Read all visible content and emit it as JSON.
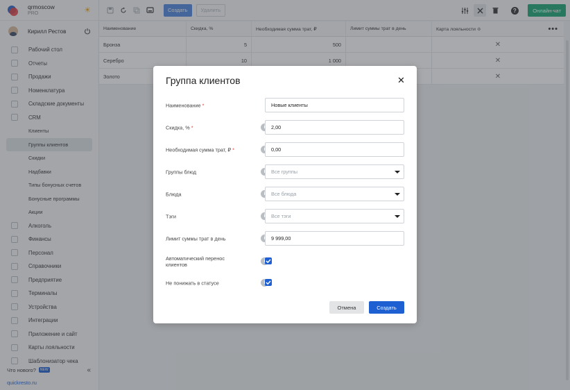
{
  "brand": {
    "name": "qrmoscow",
    "plan": "PRO"
  },
  "user": {
    "name": "Кирилл Рестов"
  },
  "sidebar": {
    "items": [
      {
        "label": "Рабочий стол",
        "icon": "home-icon"
      },
      {
        "label": "Отчеты",
        "icon": "chart-icon"
      },
      {
        "label": "Продажи",
        "icon": "sales-icon"
      },
      {
        "label": "Номенклатура",
        "icon": "tag-icon"
      },
      {
        "label": "Складские документы",
        "icon": "document-icon"
      },
      {
        "label": "CRM",
        "icon": "crm-icon"
      }
    ],
    "crm_sub": [
      {
        "label": "Клиенты"
      },
      {
        "label": "Группы клиентов",
        "active": true
      },
      {
        "label": "Скидки"
      },
      {
        "label": "Надбавки"
      },
      {
        "label": "Типы бонусных счетов"
      },
      {
        "label": "Бонусные программы"
      },
      {
        "label": "Акции"
      }
    ],
    "items_after": [
      {
        "label": "Алкоголь",
        "icon": "glass-icon"
      },
      {
        "label": "Финансы",
        "icon": "wallet-icon"
      },
      {
        "label": "Персонал",
        "icon": "staff-icon"
      },
      {
        "label": "Справочники",
        "icon": "book-icon"
      },
      {
        "label": "Предприятие",
        "icon": "building-icon"
      },
      {
        "label": "Терминалы",
        "icon": "terminal-icon"
      },
      {
        "label": "Устройства",
        "icon": "device-icon"
      },
      {
        "label": "Интеграции",
        "icon": "link-icon"
      },
      {
        "label": "Приложение и сайт",
        "icon": "app-icon"
      },
      {
        "label": "Карты лояльности",
        "icon": "card-icon"
      },
      {
        "label": "Шаблонизатор чека",
        "icon": "receipt-icon"
      }
    ],
    "whats_new": "Что нового?",
    "new_badge": "NEW",
    "site": "quickresto.ru"
  },
  "toolbar": {
    "create_label": "Создать",
    "delete_label": "Удалить",
    "chat_label": "Онлайн-чат"
  },
  "table": {
    "headers": [
      "Наименование",
      "Скидка, %",
      "Необходимая сумма трат, ₽",
      "Лимит суммы трат в день",
      "Карта лояльности ≎"
    ],
    "rows": [
      {
        "name": "Бронза",
        "discount": "5",
        "sum": "500",
        "limit": "",
        "card": "✕"
      },
      {
        "name": "Серебро",
        "discount": "10",
        "sum": "1 000",
        "limit": "",
        "card": "✕"
      },
      {
        "name": "Золото",
        "discount": "",
        "sum": "",
        "limit": "",
        "card": "✕"
      }
    ]
  },
  "modal": {
    "title": "Группа клиентов",
    "fields": {
      "name_label": "Наименование",
      "name_value": "Новые клиенты",
      "discount_label": "Скидка, %",
      "discount_value": "2,00",
      "sum_label": "Необходимая сумма трат, ₽",
      "sum_value": "0,00",
      "dish_groups_label": "Группы блюд",
      "dish_groups_placeholder": "Все группы",
      "dishes_label": "Блюда",
      "dishes_placeholder": "Все блюда",
      "tags_label": "Тэги",
      "tags_placeholder": "Все тэги",
      "limit_label": "Лимит суммы трат в день",
      "limit_value": "9 999,00",
      "auto_transfer_label": "Автоматический перенос клиентов",
      "auto_transfer_checked": true,
      "no_downgrade_label": "Не понижать в статусе",
      "no_downgrade_checked": true
    },
    "cancel_label": "Отмена",
    "create_label": "Создать"
  },
  "colors": {
    "accent": "#1e5fd2",
    "chat": "#17a673",
    "required": "#e23a3a"
  }
}
